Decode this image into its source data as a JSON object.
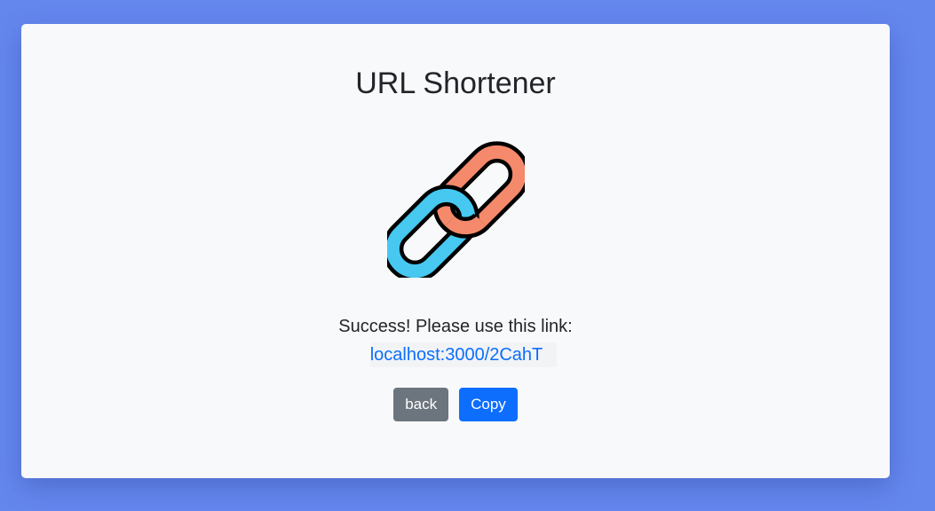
{
  "page": {
    "title": "URL Shortener",
    "logo_icon": "chain-link-icon"
  },
  "result": {
    "message": "Success! Please use this link:",
    "short_link": "localhost:3000/2CahT"
  },
  "actions": {
    "back_label": "back",
    "copy_label": "Copy"
  },
  "colors": {
    "page_background": "#6487ee",
    "card_background": "#f8f9fa",
    "link": "#0d6efd",
    "back_button": "#6c757d",
    "copy_button": "#0d6efd",
    "chain_orange": "#f5896b",
    "chain_blue": "#46c8f0"
  }
}
